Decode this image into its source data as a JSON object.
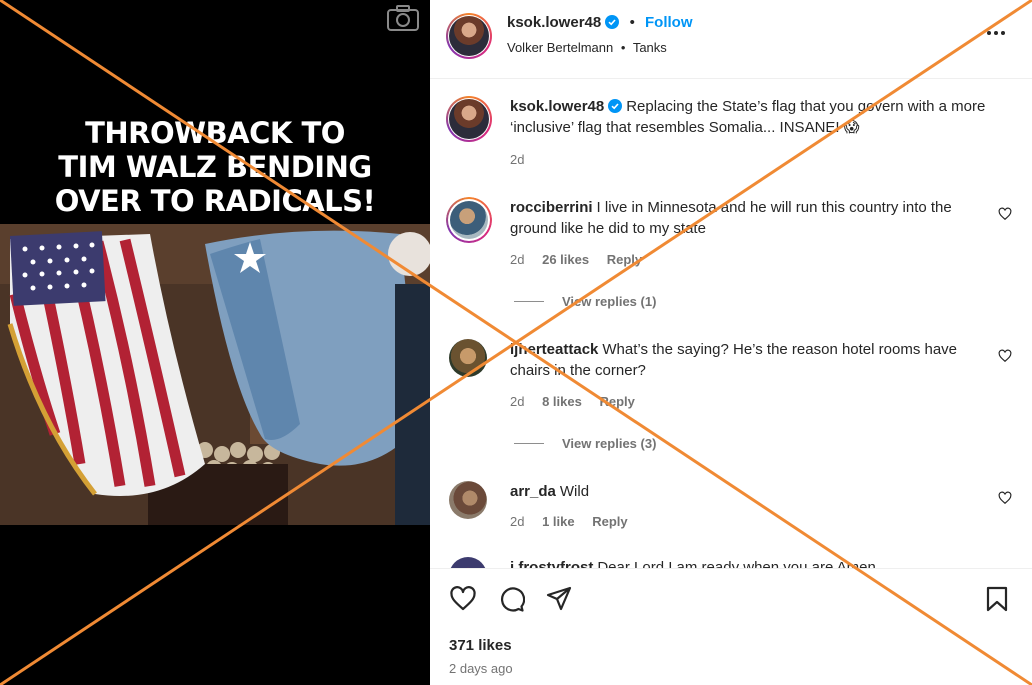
{
  "media": {
    "headline_lines": [
      "THROWBACK TO",
      "TIM WALZ BENDING",
      "OVER TO RADICALS!"
    ],
    "camera_icon": "camera-icon"
  },
  "header": {
    "username": "ksok.lower48",
    "separator": "•",
    "follow_label": "Follow",
    "audio_artist": "Volker Bertelmann",
    "audio_sep": "•",
    "audio_track": "Tanks",
    "more_icon": "more-options-icon"
  },
  "caption": {
    "username": "ksok.lower48",
    "text": "Replacing the State’s flag that you govern with a more ‘inclusive’ flag that resembles Somalia... INSANE! 😱",
    "age": "2d"
  },
  "comments": [
    {
      "username": "rocciberrini",
      "text": "I live in Minnesota and he will run this country into the ground like he did to my state",
      "age": "2d",
      "likes": "26 likes",
      "reply": "Reply",
      "view_replies": "View replies (1)"
    },
    {
      "username": "ljherteattack",
      "text": "What’s the saying? He’s the reason hotel rooms have chairs in the corner?",
      "age": "2d",
      "likes": "8 likes",
      "reply": "Reply",
      "view_replies": "View replies (3)"
    },
    {
      "username": "arr_da",
      "text": "Wild",
      "age": "2d",
      "likes": "1 like",
      "reply": "Reply"
    },
    {
      "username": "j.frostyfrost",
      "text": "Dear Lord I am ready when you are Amen"
    }
  ],
  "actions": {
    "like_icon": "heart-icon",
    "comment_icon": "comment-icon",
    "share_icon": "share-icon",
    "save_icon": "bookmark-icon",
    "likes": "371 likes",
    "post_age": "2 days ago"
  },
  "colors": {
    "link_blue": "#0095f6",
    "muted": "#737373",
    "overlay_orange": "#f08a34",
    "verified_blue": "#0095f6"
  }
}
